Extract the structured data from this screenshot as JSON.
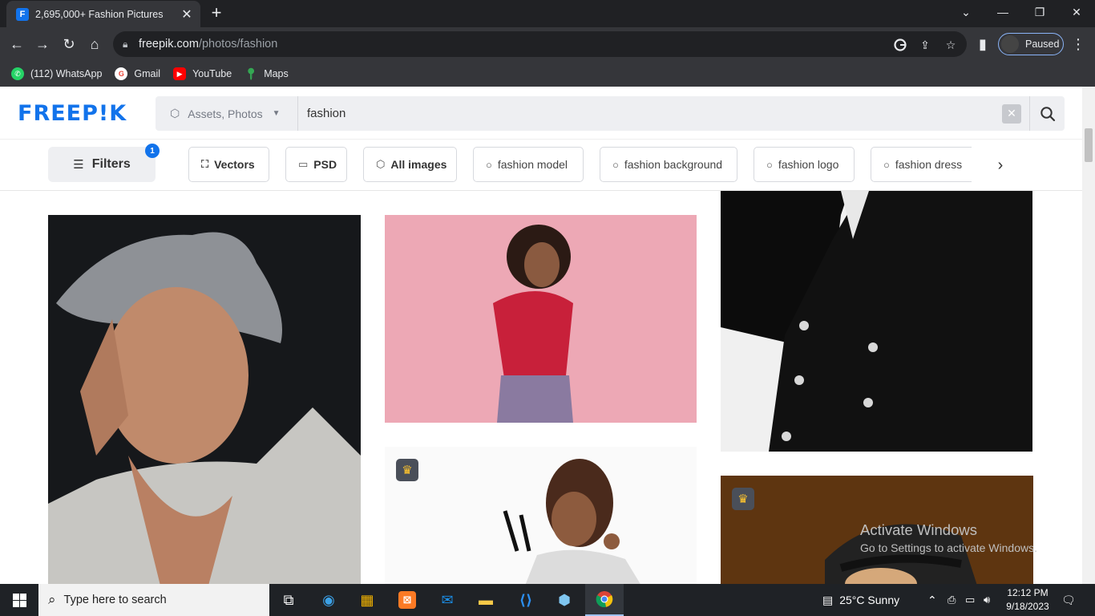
{
  "browser": {
    "tab_title": "2,695,000+ Fashion Pictures",
    "tab_favicon_letter": "F",
    "url_domain": "freepik.com",
    "url_path": "/photos/fashion",
    "profile_status": "Paused",
    "bookmarks": [
      {
        "label": "(112) WhatsApp",
        "icon": "whatsapp-icon",
        "color": "#25d366"
      },
      {
        "label": "Gmail",
        "icon": "google-icon",
        "color": "#ea4335"
      },
      {
        "label": "YouTube",
        "icon": "youtube-icon",
        "color": "#ff0000"
      },
      {
        "label": "Maps",
        "icon": "maps-icon",
        "color": "#34a853"
      }
    ]
  },
  "site": {
    "logo": "FREEP!K",
    "brand_color": "#1273eb",
    "search_type": "Assets, Photos",
    "search_query": "fashion",
    "filters_label": "Filters",
    "filters_count": "1",
    "chips": [
      {
        "label": "Vectors",
        "icon": "vectors-icon"
      },
      {
        "label": "PSD",
        "icon": "psd-icon"
      },
      {
        "label": "All images",
        "icon": "images-icon"
      },
      {
        "label": "fashion model",
        "icon": "search-icon"
      },
      {
        "label": "fashion background",
        "icon": "search-icon"
      },
      {
        "label": "fashion logo",
        "icon": "search-icon"
      },
      {
        "label": "fashion dress",
        "icon": "search-icon"
      }
    ]
  },
  "watermark": {
    "line1": "Activate Windows",
    "line2": "Go to Settings to activate Windows."
  },
  "taskbar": {
    "search_placeholder": "Type here to search",
    "weather": "25°C  Sunny",
    "time": "12:12 PM",
    "date": "9/18/2023"
  }
}
